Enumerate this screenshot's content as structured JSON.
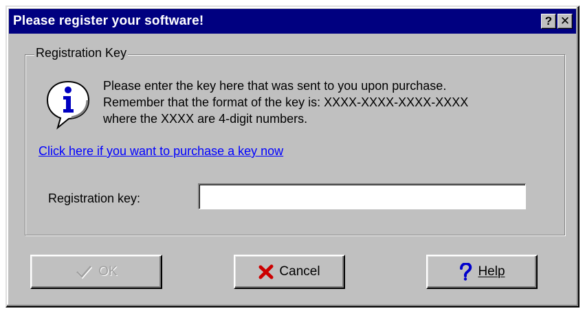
{
  "window": {
    "title": "Please register your software!",
    "help_glyph": "?",
    "close_glyph": "✕"
  },
  "group": {
    "label": "Registration Key"
  },
  "message": {
    "line1": "Please enter the key here that was sent to you upon purchase.",
    "line2": "Remember that the format of the key is:  XXXX-XXXX-XXXX-XXXX",
    "line3": "where the XXXX are 4-digit numbers."
  },
  "purchase_link": "Click here if you want to purchase a key now",
  "registration": {
    "label": "Registration key:",
    "value": ""
  },
  "buttons": {
    "ok": {
      "label": "OK",
      "icon": "checkmark-icon",
      "enabled": false
    },
    "cancel": {
      "label": "Cancel",
      "icon": "red-x-icon"
    },
    "help": {
      "label": "Help",
      "icon": "question-mark-icon"
    }
  },
  "colors": {
    "titlebar": "#000080",
    "face": "#c0c0c0",
    "link": "#0000ff",
    "cancel_icon": "#cc0000",
    "help_icon": "#0000cc"
  }
}
